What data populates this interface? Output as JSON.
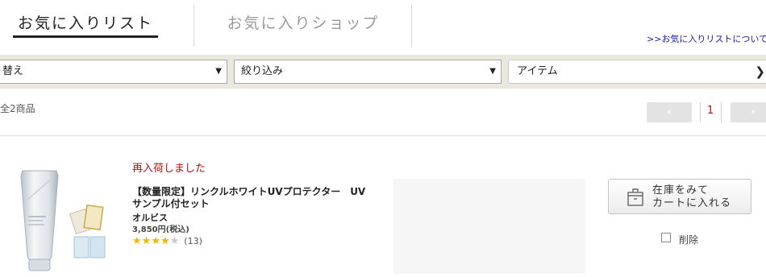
{
  "tabs": {
    "favorites_list": "お気に入りリスト",
    "favorite_shops": "お気に入りショップ"
  },
  "about_link": ">>お気に入りリストについて",
  "filters": {
    "sort_label": "替え",
    "refine_label": "絞り込み",
    "item_label": "アイテム"
  },
  "results": {
    "count_text": "全2商品",
    "current_page": "1"
  },
  "product": {
    "status": "再入荷しました",
    "name": "【数量限定】リンクルホワイトUVプロテクター　UV サンプル付セット",
    "brand": "オルビス",
    "price": "3,850円(税込)",
    "rating": 4,
    "rating_max": 5,
    "review_count": "(13)"
  },
  "actions": {
    "cart_line1": "在庫をみて",
    "cart_line2": "カートに入れる",
    "delete_label": "削除"
  },
  "colors": {
    "tab_active": "#222222",
    "tab_inactive": "#9a9a9a",
    "link": "#1a1aa6",
    "filter_bar_bg": "#ebe9de",
    "restock_red": "#b01010",
    "star_on": "#f5b400",
    "star_off": "#c8c8c8"
  },
  "icons": {
    "prev": "chevron-left-icon",
    "next": "chevron-right-icon",
    "cart": "package-box-icon",
    "dropdown": "triangle-down-icon"
  }
}
